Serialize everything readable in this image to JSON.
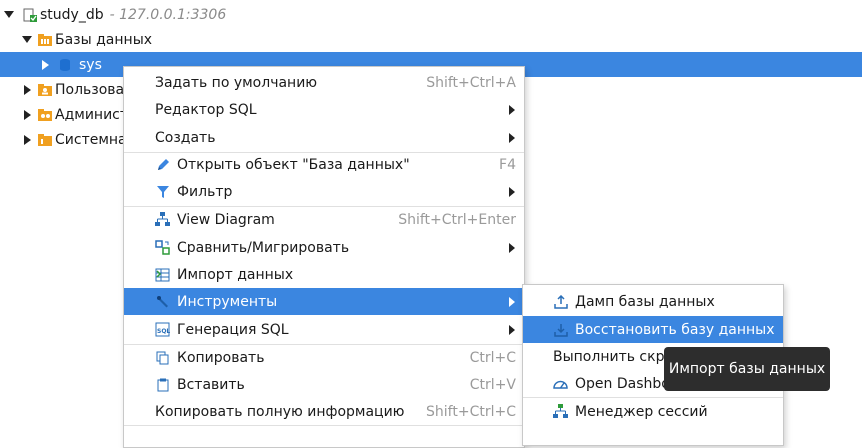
{
  "tree": {
    "connection": {
      "name": "study_db",
      "host": "- 127.0.0.1:3306"
    },
    "databases_label": "Базы данных",
    "selected_db": "sys",
    "users_label": "Пользоват",
    "admin_label": "Администр",
    "system_label": "Системная"
  },
  "context_menu": {
    "items": [
      {
        "label": "Задать по умолчанию",
        "shortcut": "Shift+Ctrl+A"
      },
      {
        "label": "Редактор SQL"
      },
      {
        "label": "Создать"
      },
      {
        "label": "Открыть объект \"База данных\"",
        "shortcut": "F4"
      },
      {
        "label": "Фильтр"
      },
      {
        "label": "View Diagram",
        "shortcut": "Shift+Ctrl+Enter"
      },
      {
        "label": "Сравнить/Мигрировать"
      },
      {
        "label": "Импорт данных"
      },
      {
        "label": "Инструменты"
      },
      {
        "label": "Генерация SQL"
      },
      {
        "label": "Копировать",
        "shortcut": "Ctrl+C"
      },
      {
        "label": "Вставить",
        "shortcut": "Ctrl+V"
      },
      {
        "label": "Копировать полную информацию",
        "shortcut": "Shift+Ctrl+C"
      }
    ]
  },
  "submenu": {
    "items": [
      {
        "label": "Дамп базы данных"
      },
      {
        "label": "Восстановить базу данных"
      },
      {
        "label": "Выполнить скрипт"
      },
      {
        "label": "Open Dashboard"
      },
      {
        "label": "Менеджер сессий"
      }
    ]
  },
  "tooltip": {
    "text": "Импорт базы данных"
  },
  "colors": {
    "selection": "#3b86e0",
    "tooltip_bg": "#2d2d2d"
  }
}
